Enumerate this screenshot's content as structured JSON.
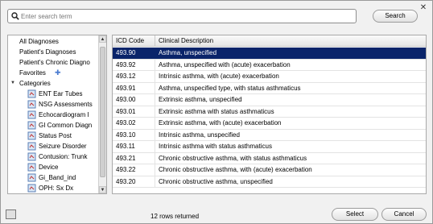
{
  "search": {
    "placeholder": "Enter search term",
    "button_label": "Search"
  },
  "tree": {
    "items": [
      {
        "label": "All Diagnoses"
      },
      {
        "label": "Patient's Diagnoses"
      },
      {
        "label": "Patient's Chronic Diagno"
      },
      {
        "label": "Favorites"
      },
      {
        "label": "Categories"
      },
      {
        "label": "ENT Ear Tubes"
      },
      {
        "label": "NSG Assessments"
      },
      {
        "label": "Echocardiogram I"
      },
      {
        "label": "GI Common Diagn"
      },
      {
        "label": "Status Post"
      },
      {
        "label": "Seizure Disorder"
      },
      {
        "label": "Contusion: Trunk"
      },
      {
        "label": "Device"
      },
      {
        "label": "Gi_Band_ind"
      },
      {
        "label": "OPH: Sx Dx"
      }
    ]
  },
  "table": {
    "headers": [
      "ICD Code",
      "Clinical Description"
    ],
    "rows": [
      {
        "code": "493.90",
        "desc": "Asthma, unspecified"
      },
      {
        "code": "493.92",
        "desc": "Asthma, unspecified with (acute) exacerbation"
      },
      {
        "code": "493.12",
        "desc": "Intrinsic asthma, with (acute) exacerbation"
      },
      {
        "code": "493.91",
        "desc": "Asthma, unspecified type, with status asthmaticus"
      },
      {
        "code": "493.00",
        "desc": "Extrinsic asthma, unspecified"
      },
      {
        "code": "493.01",
        "desc": "Extrinsic asthma with status asthmaticus"
      },
      {
        "code": "493.02",
        "desc": "Extrinsic asthma, with (acute) exacerbation"
      },
      {
        "code": "493.10",
        "desc": "Intrinsic asthma, unspecified"
      },
      {
        "code": "493.11",
        "desc": "Intrinsic asthma with status asthmaticus"
      },
      {
        "code": "493.21",
        "desc": "Chronic obstructive asthma, with status asthmaticus"
      },
      {
        "code": "493.22",
        "desc": "Chronic obstructive asthma, with (acute) exacerbation"
      },
      {
        "code": "493.20",
        "desc": "Chronic obstructive asthma, unspecified"
      }
    ]
  },
  "footer": {
    "rows_returned": "12 rows returned",
    "select_label": "Select",
    "cancel_label": "Cancel"
  },
  "colors": {
    "selection": "#0a246a"
  }
}
